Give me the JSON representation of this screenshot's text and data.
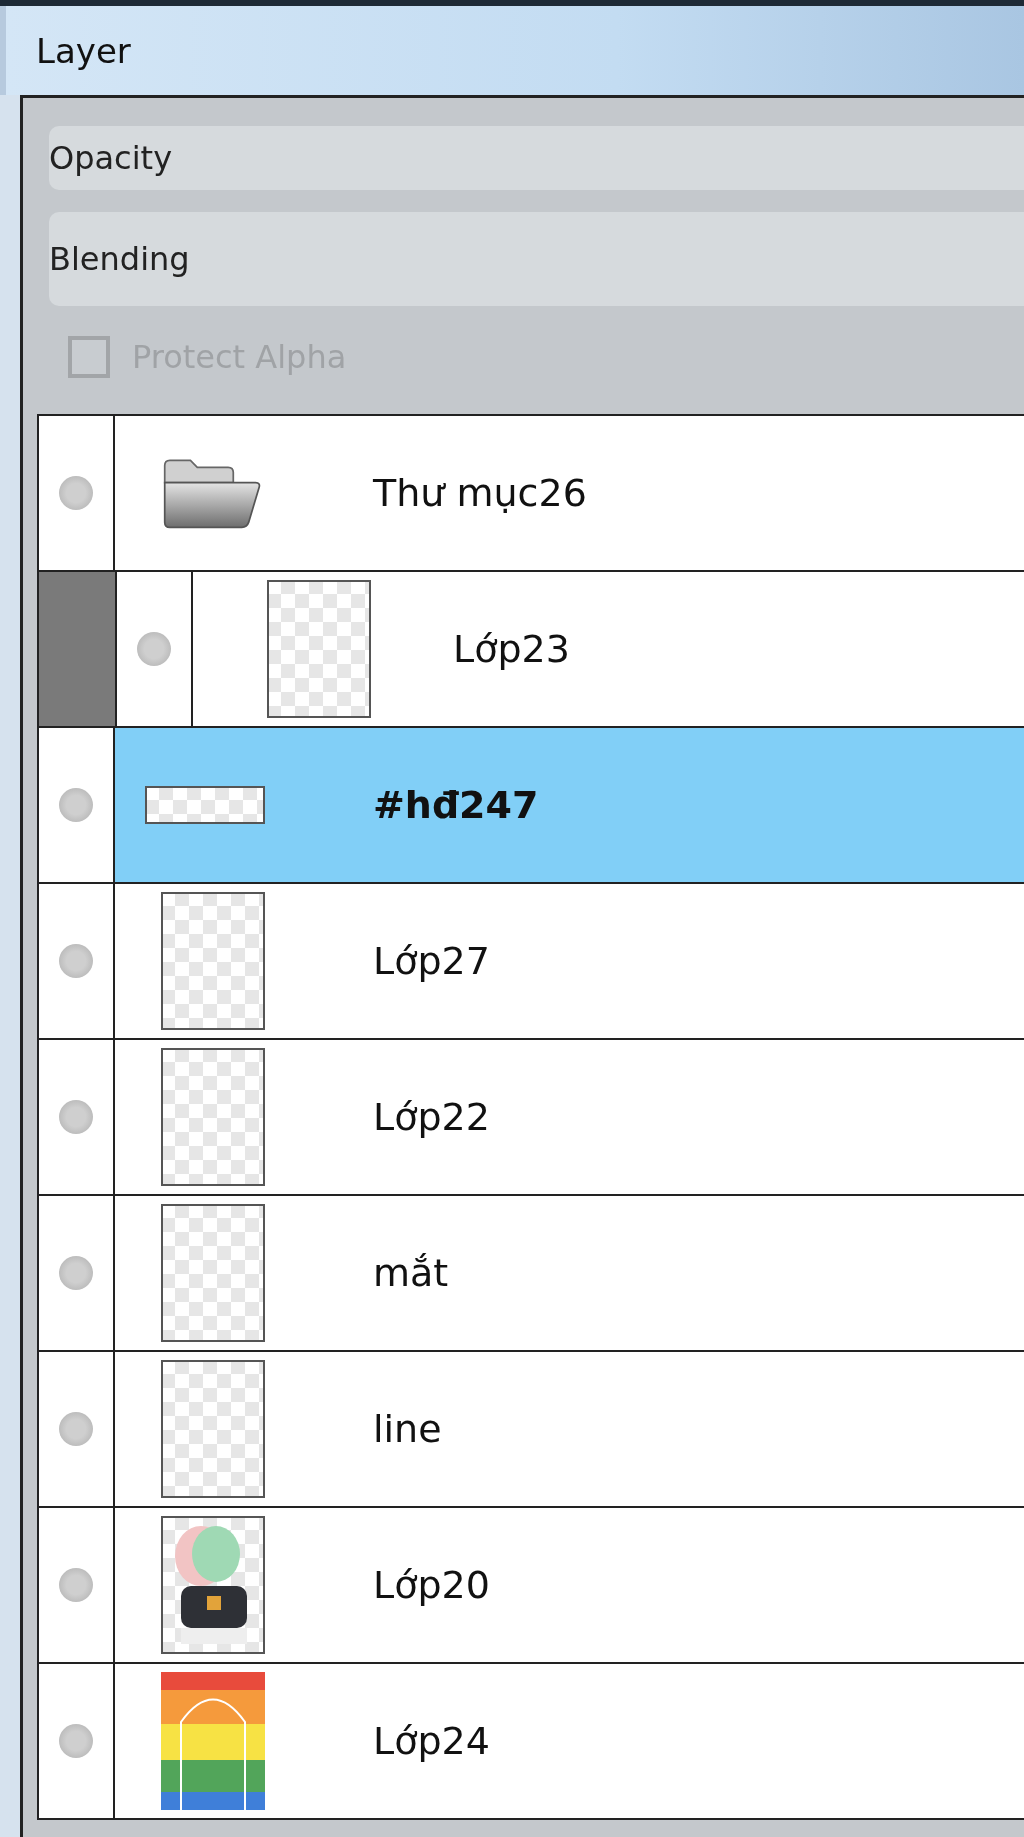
{
  "window": {
    "title": "Layer"
  },
  "fields": [
    {
      "label": "Opacity"
    },
    {
      "label": "Blending"
    }
  ],
  "protect_alpha": {
    "label": "Protect Alpha",
    "checked": false,
    "disabled": true
  },
  "layers": [
    {
      "kind": "folder",
      "name": "Thư mục26",
      "selected": false,
      "children": [
        {
          "kind": "blank",
          "name": "Lớp23",
          "selected": false
        }
      ]
    },
    {
      "kind": "strip",
      "name": "#hđ247",
      "selected": true
    },
    {
      "kind": "blank",
      "name": "Lớp27",
      "selected": false
    },
    {
      "kind": "blank",
      "name": "Lớp22",
      "selected": false
    },
    {
      "kind": "blank",
      "name": "mắt",
      "selected": false
    },
    {
      "kind": "blank",
      "name": "line",
      "selected": false
    },
    {
      "kind": "figure",
      "name": "Lớp20",
      "selected": false
    },
    {
      "kind": "stripes",
      "name": "Lớp24",
      "selected": false
    }
  ]
}
